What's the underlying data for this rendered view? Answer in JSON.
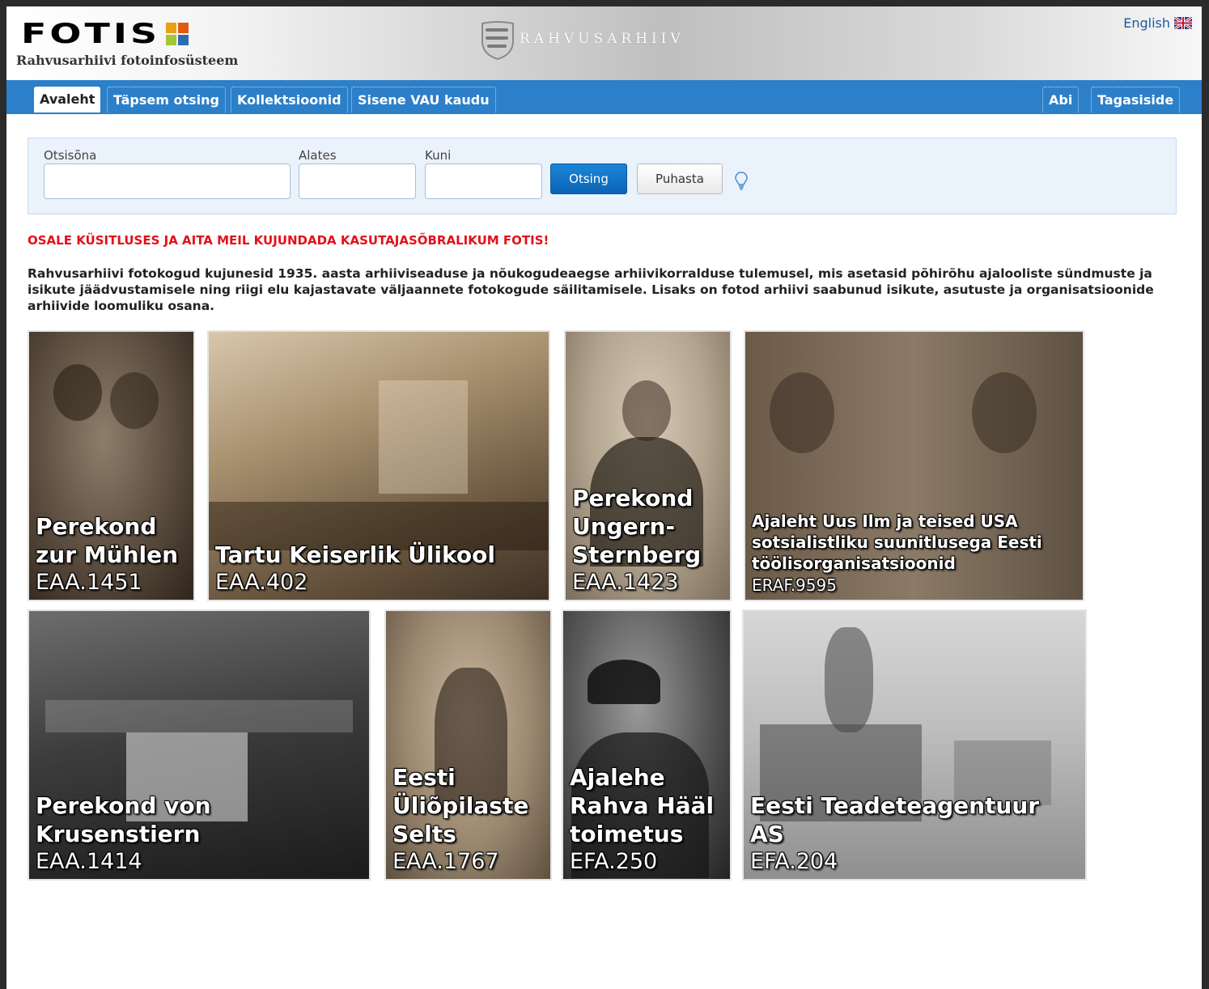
{
  "header": {
    "logo_text": "FOTIS",
    "tagline": "Rahvusarhiivi fotoinfosüsteem",
    "archive_name": "RAHVUSARHIIV",
    "language_link": "English"
  },
  "nav": {
    "tabs": [
      {
        "label": "Avaleht",
        "active": true
      },
      {
        "label": "Täpsem otsing",
        "active": false
      },
      {
        "label": "Kollektsioonid",
        "active": false
      },
      {
        "label": "Sisene VAU kaudu",
        "active": false
      }
    ],
    "right_tabs": [
      {
        "label": "Abi"
      },
      {
        "label": "Tagasiside"
      }
    ]
  },
  "search": {
    "keyword_label": "Otsisõna",
    "keyword_value": "",
    "from_label": "Alates",
    "from_value": "",
    "to_label": "Kuni",
    "to_value": "",
    "search_button": "Otsing",
    "clear_button": "Puhasta"
  },
  "notice": "OSALE KÜSITLUSES JA AITA MEIL KUJUNDADA KASUTAJASÕBRALIKUM FOTIS!",
  "intro": "Rahvusarhiivi fotokogud kujunesid 1935. aasta arhiiviseaduse ja nõukogudeaegse arhiivikorralduse tulemusel, mis asetasid põhirõhu ajalooliste sündmuste ja isikute jäädvustamisele ning riigi elu kajastavate väljaannete fotokogude säilitamisele. Lisaks on fotod arhiivi saabunud isikute, asutuste ja organisatsioonide arhiivide loomuliku osana.",
  "collections": [
    {
      "title": "Perekond zur Mühlen",
      "code": "EAA.1451"
    },
    {
      "title": "Tartu Keiserlik Ülikool",
      "code": "EAA.402"
    },
    {
      "title": "Perekond Ungern-Sternberg",
      "code": "EAA.1423"
    },
    {
      "title": "Ajaleht Uus Ilm ja teised USA sotsialistliku suunitlusega Eesti töölisorganisatsioonid",
      "code": "ERAF.9595"
    },
    {
      "title": "Perekond von Krusenstiern",
      "code": "EAA.1414"
    },
    {
      "title": "Eesti Üliõpilaste Selts",
      "code": "EAA.1767"
    },
    {
      "title": "Ajalehe Rahva Hääl toimetus",
      "code": "EFA.250"
    },
    {
      "title": "Eesti Teadeteagentuur AS",
      "code": "EFA.204"
    }
  ],
  "colors": {
    "nav_blue": "#2c7fc9",
    "notice_red": "#e2111a",
    "link_blue": "#1a5a9e"
  }
}
